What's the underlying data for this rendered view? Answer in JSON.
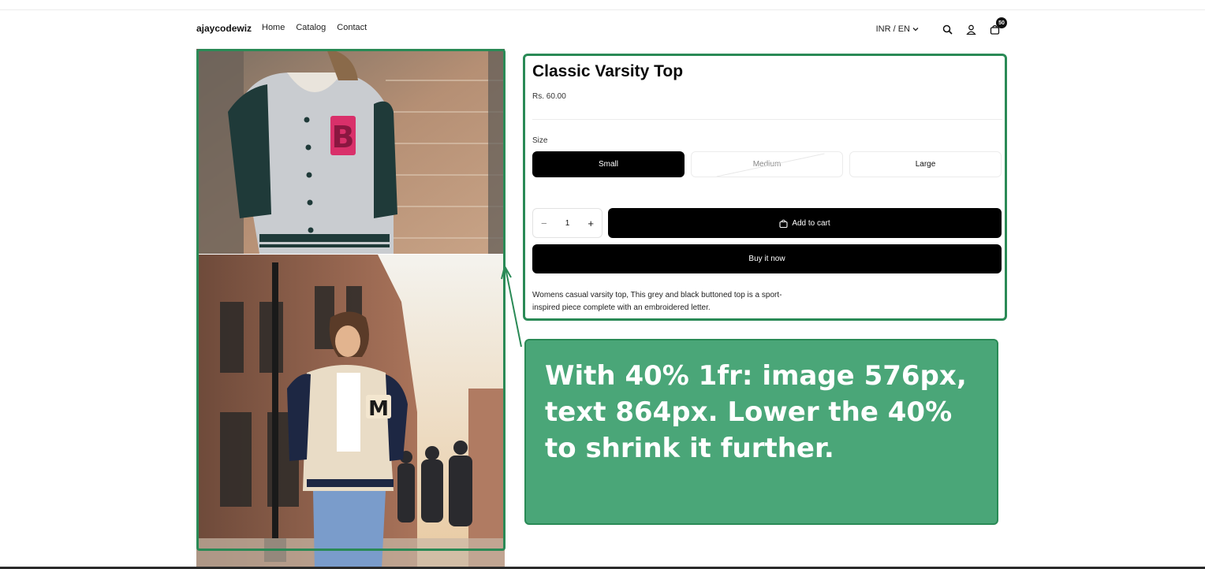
{
  "header": {
    "brand": "ajaycodewiz",
    "nav": [
      "Home",
      "Catalog",
      "Contact"
    ],
    "currency": "INR / EN",
    "cart_count": "50",
    "icons": [
      "search-icon",
      "user-icon",
      "cart-icon",
      "chevron-down-icon"
    ]
  },
  "product": {
    "title": "Classic Varsity Top",
    "price": "Rs. 60.00",
    "size_label": "Size",
    "sizes": [
      "Small",
      "Medium",
      "Large"
    ],
    "selected_size": "Small",
    "quantity": "1",
    "add_to_cart": "Add to cart",
    "buy_now": "Buy it now",
    "description": "Womens casual varsity top, This grey and black buttoned top is a sport-inspired piece complete with an embroidered letter."
  },
  "annotation": {
    "text": "With 40% 1fr: image 576px, text 864px. Lower the 40% to shrink it further.",
    "color": "#4aa678",
    "outline_color": "#2a8a56"
  }
}
